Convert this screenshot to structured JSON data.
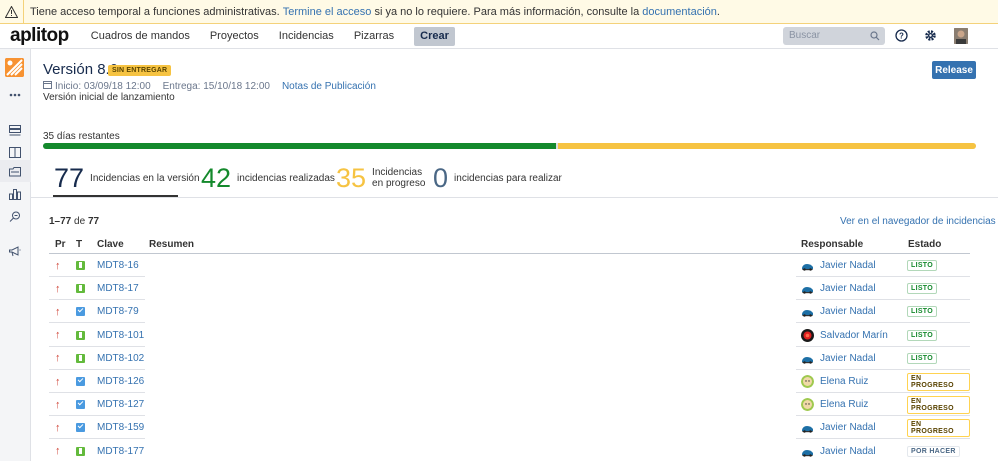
{
  "banner": {
    "text_before": "Tiene acceso temporal a funciones administrativas.",
    "link1": "Termine el acceso",
    "text_middle": "si ya no lo requiere. Para más información, consulte la",
    "link2": "documentación",
    "text_after": "."
  },
  "nav": {
    "logo": "aplitop",
    "items": [
      "Cuadros de mandos",
      "Proyectos",
      "Incidencias",
      "Pizarras"
    ],
    "create_label": "Crear",
    "search_placeholder": "Buscar"
  },
  "version": {
    "title": "Versión 8.0",
    "badge": "SIN ENTREGAR",
    "release_label": "Release",
    "start": "Inicio: 03/09/18 12:00",
    "due": "Entrega: 15/10/18 12:00",
    "notes_link": "Notas de Publicación",
    "description": "Versión inicial de lanzamiento"
  },
  "progress": {
    "days_remaining": "35 días restantes",
    "done_fraction": 0.55,
    "in_progress_fraction": 0.45,
    "colors": {
      "done": "#14892c",
      "in_progress": "#f6c342"
    }
  },
  "stats": [
    {
      "value": "77",
      "label": "Incidencias en la versión",
      "color": "#333333"
    },
    {
      "value": "42",
      "label": "incidencias realizadas",
      "color": "#14892c"
    },
    {
      "value": "35",
      "label_line1": "Incidencias",
      "label_line2": "en progreso",
      "color": "#f6c342"
    },
    {
      "value": "0",
      "label": "incidencias para realizar",
      "color": "#4a6785"
    }
  ],
  "table": {
    "count_range": "1–77",
    "count_of": "de",
    "count_total": "77",
    "navigator_link": "Ver en el navegador de incidencias",
    "headers": {
      "priority": "Pr",
      "type": "T",
      "key": "Clave",
      "summary": "Resumen",
      "assignee": "Responsable",
      "status": "Estado"
    },
    "rows": [
      {
        "priority": "↑",
        "type": "story",
        "key": "MDT8-16",
        "assignee": "Javier Nadal",
        "avatar": "car",
        "status": "LISTO"
      },
      {
        "priority": "↑",
        "type": "story",
        "key": "MDT8-17",
        "assignee": "Javier Nadal",
        "avatar": "car",
        "status": "LISTO"
      },
      {
        "priority": "↑",
        "type": "task",
        "key": "MDT8-79",
        "assignee": "Javier Nadal",
        "avatar": "car",
        "status": "LISTO"
      },
      {
        "priority": "↑",
        "type": "story",
        "key": "MDT8-101",
        "assignee": "Salvador Marín",
        "avatar": "red",
        "status": "LISTO"
      },
      {
        "priority": "↑",
        "type": "story",
        "key": "MDT8-102",
        "assignee": "Javier Nadal",
        "avatar": "car",
        "status": "LISTO"
      },
      {
        "priority": "↑",
        "type": "task",
        "key": "MDT8-126",
        "assignee": "Elena Ruiz",
        "avatar": "face",
        "status": "EN PROGRESO"
      },
      {
        "priority": "↑",
        "type": "task",
        "key": "MDT8-127",
        "assignee": "Elena Ruiz",
        "avatar": "face",
        "status": "EN PROGRESO"
      },
      {
        "priority": "↑",
        "type": "task",
        "key": "MDT8-159",
        "assignee": "Javier Nadal",
        "avatar": "car",
        "status": "EN PROGRESO"
      },
      {
        "priority": "↑",
        "type": "story",
        "key": "MDT8-177",
        "assignee": "Javier Nadal",
        "avatar": "car",
        "status": "POR HACER"
      }
    ]
  }
}
